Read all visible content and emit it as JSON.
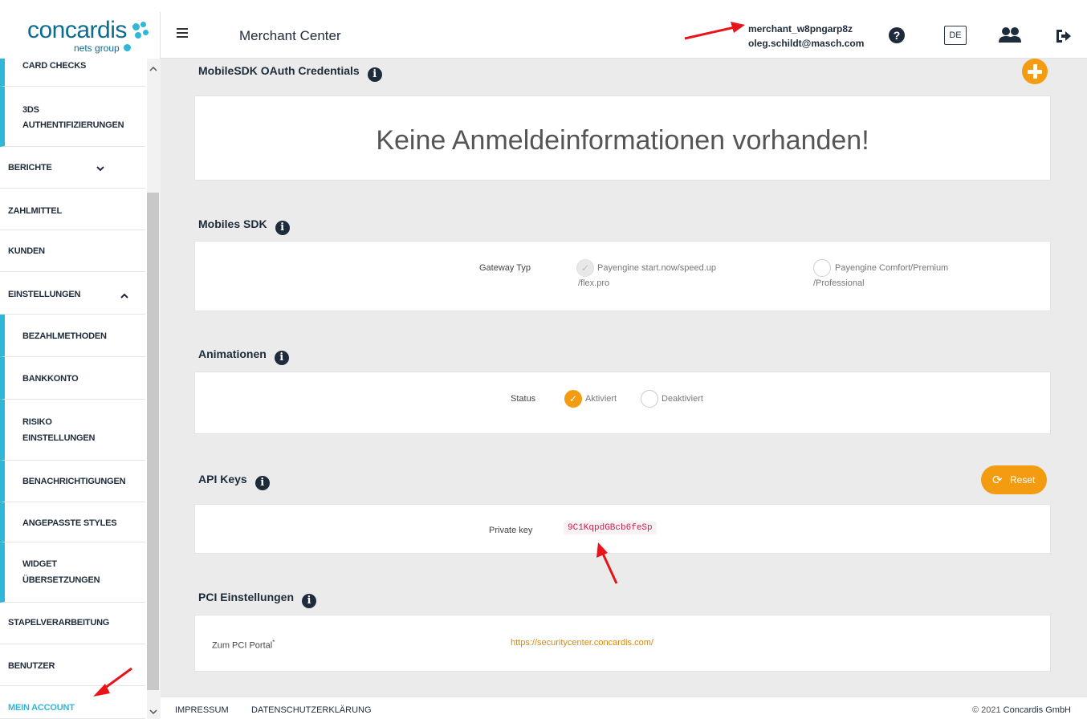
{
  "brand": {
    "name": "concardis",
    "sub": "nets group"
  },
  "header": {
    "title": "Merchant Center",
    "merchant_id": "merchant_w8pngarp8z",
    "email": "oleg.schildt@masch.com",
    "lang": "DE"
  },
  "sidebar": {
    "items": [
      {
        "label": "CARD CHECKS"
      },
      {
        "label": "3DS",
        "label2": "AUTHENTIFIZIERUNGEN"
      },
      {
        "label": "BERICHTE"
      },
      {
        "label": "ZAHLMITTEL"
      },
      {
        "label": "KUNDEN"
      },
      {
        "label": "EINSTELLUNGEN"
      },
      {
        "label": "BEZAHLMETHODEN"
      },
      {
        "label": "BANKKONTO"
      },
      {
        "label": "RISIKO",
        "label2": "EINSTELLUNGEN"
      },
      {
        "label": "BENACHRICHTIGUNGEN"
      },
      {
        "label": "ANGEPASSTE STYLES"
      },
      {
        "label": "WIDGET",
        "label2": "ÜBERSETZUNGEN"
      },
      {
        "label": "STAPELVERARBEITUNG"
      },
      {
        "label": "BENUTZER"
      },
      {
        "label": "MEIN ACCOUNT"
      }
    ]
  },
  "main": {
    "oauth": {
      "title": "MobileSDK OAuth Credentials",
      "empty": "Keine Anmeldeinformationen vorhanden!"
    },
    "sdk": {
      "title": "Mobiles SDK",
      "label": "Gateway Typ",
      "opt1_line1": "Payengine start.now/speed.up",
      "opt1_line2": "/flex.pro",
      "opt2_line1": "Payengine Comfort/Premium",
      "opt2_line2": "/Professional"
    },
    "animations": {
      "title": "Animationen",
      "label": "Status",
      "opt1": "Aktiviert",
      "opt2": "Deaktiviert"
    },
    "api": {
      "title": "API Keys",
      "reset": "Reset",
      "label": "Private key",
      "key": "9C1KqpdGBcb6feSp"
    },
    "pci": {
      "title": "PCI Einstellungen",
      "label": "Zum PCI Portal",
      "required_mark": "*",
      "link": "https://securitycenter.concardis.com/"
    }
  },
  "footer": {
    "impressum": "IMPRESSUM",
    "privacy": "DATENSCHUTZERKLÄRUNG",
    "copyright": "© 2021",
    "company": "Concardis GmbH"
  }
}
